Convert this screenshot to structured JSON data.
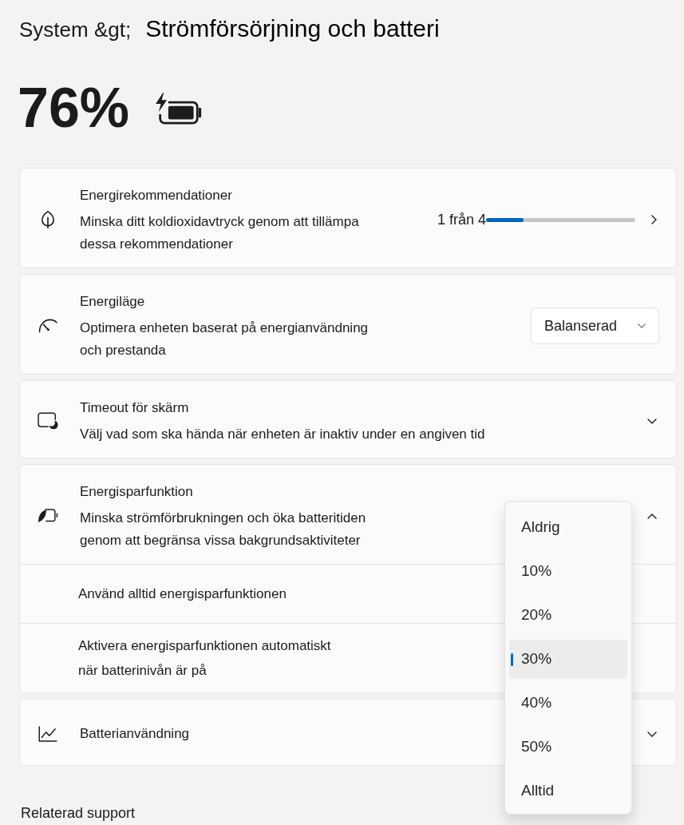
{
  "header": {
    "breadcrumb": "System &gt;",
    "title": "Strömförsörjning och batteri"
  },
  "battery": {
    "percentage": "76%",
    "charging": true
  },
  "settings": [
    {
      "kind": "progress",
      "title": "Energirekommendationer",
      "description": "Minska ditt koldioxidavtryck genom att tillämpa\ndessa rekommendationer",
      "progress_label": "1 från 4",
      "level": 0.25
    },
    {
      "kind": "dropdown",
      "title": "Energiläge",
      "description": "Optimera enheten baserat på energianvändning\noch prestanda",
      "value": "Balanserad"
    },
    {
      "kind": "expander",
      "title": "Timeout för skärm",
      "description": "Välj vad som ska hända när enheten är inaktiv under en angiven tid",
      "expanded": false
    },
    {
      "kind": "expander",
      "title": "Energisparfunktion",
      "description": "Minska strömförbrukningen och öka batteritiden\ngenom att begränsa vissa bakgrundsaktiviteter",
      "expanded": true,
      "children": [
        {
          "label": "Använd alltid energisparfunktionen"
        },
        {
          "label": "Aktivera energisparfunktionen automatiskt\nnär batterinivån är på"
        }
      ]
    },
    {
      "kind": "expander",
      "title": "Batterianvändning",
      "expanded": false
    }
  ],
  "dropdown_menu": {
    "options": [
      {
        "label": "Aldrig",
        "selected": false
      },
      {
        "label": "10%",
        "selected": false
      },
      {
        "label": "20%",
        "selected": false
      },
      {
        "label": "30%",
        "selected": true
      },
      {
        "label": "40%",
        "selected": false
      },
      {
        "label": "50%",
        "selected": false
      },
      {
        "label": "Alltid",
        "selected": false
      }
    ]
  },
  "related_support": {
    "title": "Relaterad support"
  }
}
